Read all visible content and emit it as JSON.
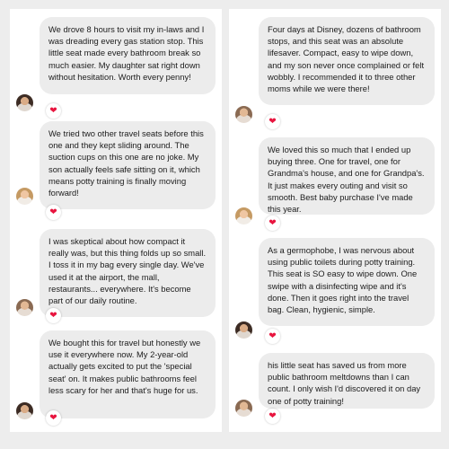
{
  "reviews_left": [
    {
      "text": "We drove 8 hours to visit my in-laws and I was dreading every gas station stop. This little seat made every bathroom break so much easier. My daughter sat right down without hesitation. Worth every penny!",
      "reaction": "❤"
    },
    {
      "text": "We tried two other travel seats before this one and they kept sliding around. The suction cups on this one are no joke. My son actually feels safe sitting on it, which means potty training is finally moving forward!",
      "reaction": "❤"
    },
    {
      "text": "I was skeptical about how compact it really was, but this thing folds up so small. I toss it in my bag every single day. We've used it at the airport, the mall, restaurants... everywhere. It's become part of our daily routine.",
      "reaction": "❤"
    },
    {
      "text": "We bought this for travel but honestly we use it everywhere now. My 2-year-old actually gets excited to put the 'special seat' on. It makes public bathrooms feel less scary for her and that's huge for us.",
      "reaction": "❤"
    }
  ],
  "reviews_right": [
    {
      "text": "Four days at Disney, dozens of bathroom stops, and this seat was an absolute lifesaver. Compact, easy to wipe down, and my son never once complained or felt wobbly. I recommended it to three other moms while we were there!",
      "reaction": "❤"
    },
    {
      "text": "We loved this so much that I ended up buying three. One for travel, one for Grandma's house, and one for Grandpa's. It just makes every outing and visit so smooth. Best baby purchase I've made this year.",
      "reaction": "❤"
    },
    {
      "text": "As a germophobe, I was nervous about using public toilets during potty training. This seat is SO easy to wipe down. One swipe with a disinfecting wipe and it's done. Then it goes right into the travel bag. Clean, hygienic, simple.",
      "reaction": "❤"
    },
    {
      "text": "his little seat has saved us from more public bathroom meltdowns than I can count. I only wish I'd discovered it on day one of potty training!",
      "reaction": "❤"
    }
  ]
}
